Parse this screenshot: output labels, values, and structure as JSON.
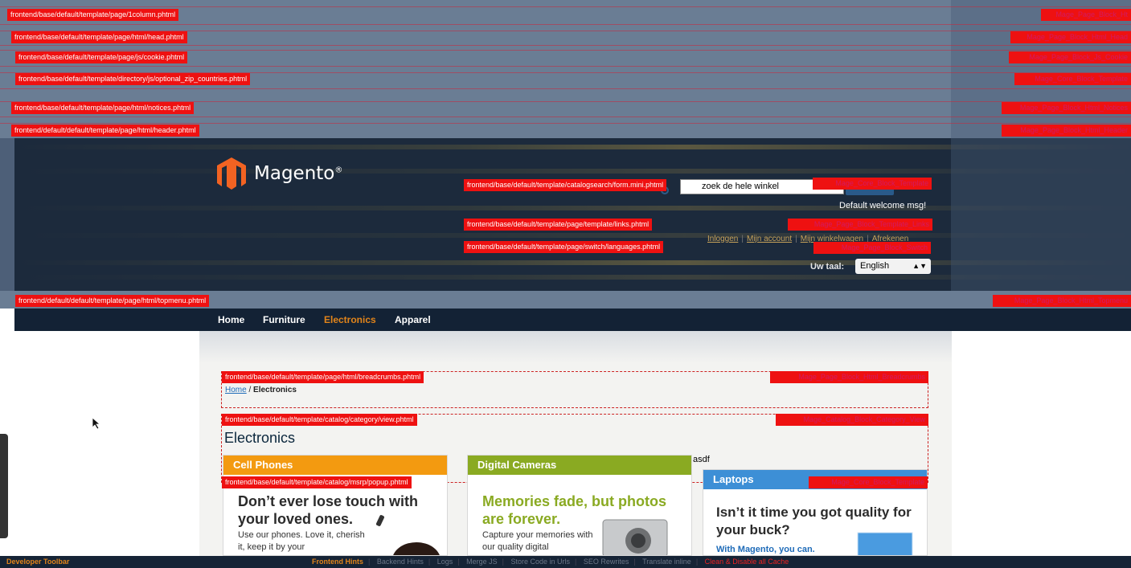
{
  "hints": {
    "page_1column": "frontend/base/default/template/page/1column.phtml",
    "page_1column_cls": "Mage_Page_Block_Ht",
    "html_head": "frontend/base/default/template/page/html/head.phtml",
    "html_head_cls": "Mage_Page_Block_Html_Head",
    "js_cookie": "frontend/base/default/template/page/js/cookie.phtml",
    "js_cookie_cls": "Mage_Page_Block_Js_Cookie",
    "optional_zip": "frontend/base/default/template/directory/js/optional_zip_countries.phtml",
    "optional_zip_cls": "Mage_Core_Block_Template",
    "notices": "frontend/base/default/template/page/html/notices.phtml",
    "notices_cls": "Mage_Page_Block_Html_Notices",
    "header": "frontend/default/default/template/page/html/header.phtml",
    "header_cls": "Mage_Page_Block_Html_Header",
    "form_mini": "frontend/base/default/template/catalogsearch/form.mini.phtml",
    "form_mini_cls": "Mage_Core_Block_Template",
    "links": "frontend/base/default/template/page/template/links.phtml",
    "links_cls": "Mage_Page_Block_Template_Links",
    "languages": "frontend/base/default/template/page/switch/languages.phtml",
    "languages_cls": "Mage_Page_Block_Switch",
    "topmenu": "frontend/default/default/template/page/html/topmenu.phtml",
    "topmenu_cls": "Mage_Page_Block_Html_Topmenu",
    "breadcrumbs": "frontend/base/default/template/page/html/breadcrumbs.phtml",
    "breadcrumbs_cls": "Mage_Page_Block_Html_Breadcrumbs",
    "category_view": "frontend/base/default/template/catalog/category/view.phtml",
    "category_view_cls": "Mage_Catalog_Block_Category_View",
    "msrp_popup": "frontend/base/default/template/catalog/msrp/popup.phtml",
    "laptops_cls": "Mage_Core_Block_Template"
  },
  "header": {
    "logo_text": "Magento",
    "logo_mark": "®",
    "search_placeholder": "zoek de hele winkel",
    "welcome": "Default welcome msg!",
    "links": [
      "Inloggen",
      "Mijn account",
      "Mijn winkelwagen",
      "Afrekenen"
    ],
    "language_label": "Uw taal:",
    "language_value": "English"
  },
  "nav": {
    "items": [
      "Home",
      "Furniture",
      "Electronics",
      "Apparel"
    ],
    "active_index": 2
  },
  "breadcrumb": {
    "home": "Home",
    "sep": " / ",
    "current": "Electronics"
  },
  "category": {
    "title": "Electronics",
    "extra_text": "asdf",
    "cards": [
      {
        "name": "Cell Phones",
        "header_color": "#f39a10",
        "headline": "Don’t ever lose touch with your loved ones.",
        "headline_color": "#2b2b2b",
        "body": "Use our phones. Love it, cherish it, keep it by your"
      },
      {
        "name": "Digital Cameras",
        "header_color": "#8aaa22",
        "headline": "Memories fade, but photos are forever.",
        "headline_color": "#8aaa22",
        "body": "Capture your memories with our quality digital"
      },
      {
        "name": "Laptops",
        "header_color": "#3d8fd6",
        "headline": "Isn’t it time you got quality for your buck?",
        "headline_color": "#2b2b2b",
        "body": "With Magento, you can."
      }
    ]
  },
  "devbar": {
    "brand": "Developer Toolbar",
    "items": [
      "Frontend Hints",
      "Backend Hints",
      "Logs",
      "Merge JS",
      "Store Code in Urls",
      "SEO Rewrites",
      "Translate inline",
      "Clean & Disable all Cache"
    ]
  },
  "colors": {
    "header_bg": "#1c2a3c",
    "hint_red": "#ee1111",
    "accent_orange": "#e2841a"
  }
}
